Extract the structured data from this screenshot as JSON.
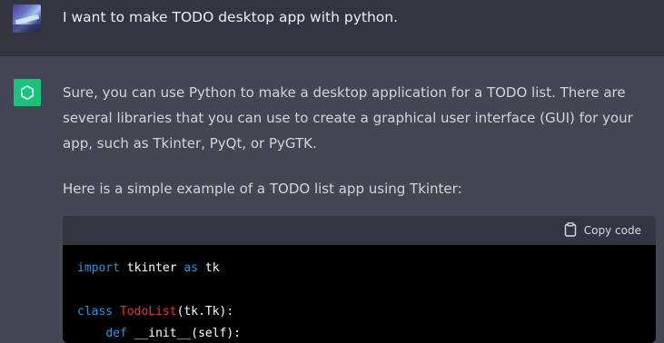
{
  "user_message": {
    "text": "I want to make TODO desktop app with python."
  },
  "assistant_message": {
    "paragraph1": "Sure, you can use Python to make a desktop application for a TODO list. There are several libraries that you can use to create a graphical user interface (GUI) for your app, such as Tkinter, PyQt, or PyGTK.",
    "paragraph2": "Here is a simple example of a TODO list app using Tkinter:"
  },
  "code_block": {
    "copy_label": "Copy code",
    "lines": {
      "l1": {
        "kw1": "import",
        "t1": " tkinter ",
        "kw2": "as",
        "t2": " tk"
      },
      "l3": {
        "kw1": "class",
        "t1": " ",
        "cls": "TodoList",
        "t2": "(tk.Tk):"
      },
      "l4": {
        "t0": "    ",
        "kw1": "def",
        "t1": " __init__(self):"
      }
    }
  },
  "icons": {
    "user_avatar": "user-avatar-image",
    "assistant_avatar": "openai-logo-icon",
    "copy": "clipboard-icon"
  },
  "colors": {
    "user_bg": "#343541",
    "assistant_bg": "#444654",
    "assistant_avatar_bg": "#19c37d",
    "code_bg": "#000000",
    "keyword": "#2e95d3",
    "class_name": "#f22c3d"
  }
}
